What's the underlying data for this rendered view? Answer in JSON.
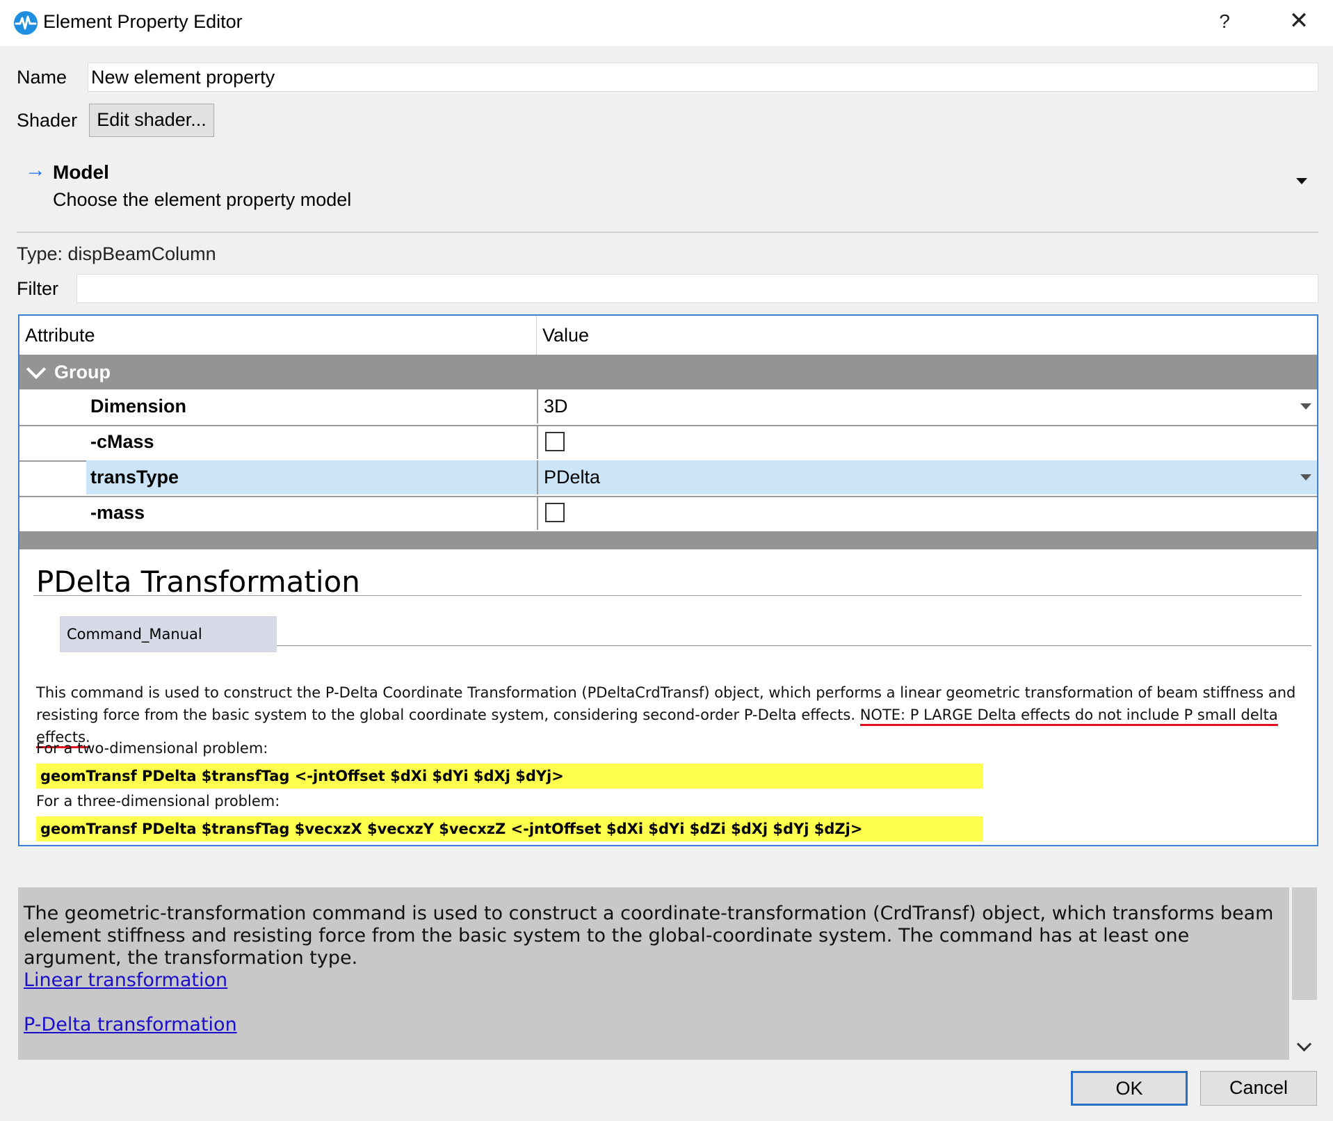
{
  "window": {
    "title": "Element Property Editor",
    "help_label": "?",
    "close_label": "✕"
  },
  "form": {
    "name_label": "Name",
    "name_value": "New element property",
    "shader_label": "Shader",
    "shader_button": "Edit shader..."
  },
  "model": {
    "arrow": "→",
    "title": "Model",
    "description": "Choose the element property model"
  },
  "type_line": "Type:  dispBeamColumn",
  "filter_label": "Filter",
  "grid": {
    "col_attribute": "Attribute",
    "col_value": "Value",
    "group_label": "Group",
    "rows": [
      {
        "attr": "Dimension",
        "value": "3D"
      },
      {
        "attr": "-cMass",
        "value": ""
      },
      {
        "attr": "transType",
        "value": "PDelta"
      },
      {
        "attr": "-mass",
        "value": ""
      }
    ]
  },
  "doc": {
    "heading": "PDelta Transformation",
    "tab": "Command_Manual",
    "para_main": "This command is used to construct the P-Delta Coordinate Transformation (PDeltaCrdTransf) object, which performs a linear geometric transformation of beam stiffness and resisting force from the basic system to the global coordinate system, considering second-order P-Delta effects. ",
    "para_note": "NOTE: P LARGE Delta effects do not include P small delta effects.",
    "two_dim_label": "For a two-dimensional problem:",
    "two_dim_code": "geomTransf PDelta $transfTag <-jntOffset $dXi $dYi $dXj $dYj>",
    "three_dim_label": "For a three-dimensional problem:",
    "three_dim_code": "geomTransf PDelta $transfTag $vecxzX $vecxzY $vecxzZ <-jntOffset $dXi $dYi $dZi $dXj $dYj $dZj>"
  },
  "description": {
    "text": "The geometric-transformation command is used to construct a coordinate-transformation (CrdTransf) object, which transforms beam element stiffness and resisting force from the basic system to the global-coordinate system. The command has at least one argument, the transformation type.",
    "link_linear": "Linear transformation",
    "link_pdelta": "P-Delta transformation"
  },
  "footer": {
    "ok": "OK",
    "cancel": "Cancel"
  },
  "colors": {
    "accent": "#2a6fc9",
    "selection": "#cce4f7",
    "code_highlight": "#ffff4d",
    "note_underline": "#e0111b",
    "link": "#1a0dcc"
  }
}
